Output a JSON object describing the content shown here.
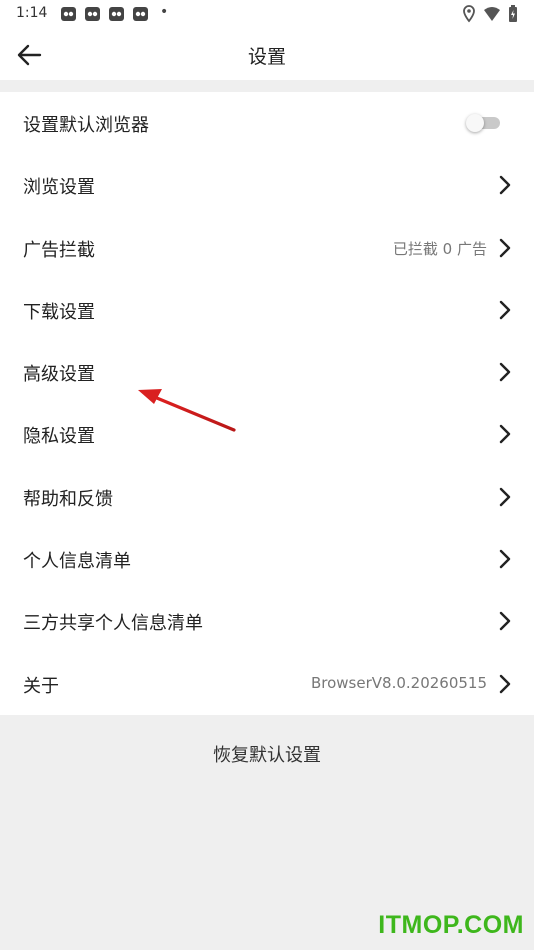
{
  "status_bar": {
    "time": "1:14",
    "notification_icons": [
      "panda-icon",
      "panda-icon",
      "panda-icon",
      "panda-icon"
    ],
    "dot": "•",
    "system_icons": [
      "location-icon",
      "wifi-icon",
      "battery-icon"
    ]
  },
  "header": {
    "title": "设置",
    "back_icon": "arrow-left-icon"
  },
  "settings": {
    "items": [
      {
        "label": "设置默认浏览器",
        "value": "",
        "control": "toggle",
        "toggle_on": false
      },
      {
        "label": "浏览设置",
        "value": "",
        "control": "chevron"
      },
      {
        "label": "广告拦截",
        "value": "已拦截 0 广告",
        "control": "chevron"
      },
      {
        "label": "下载设置",
        "value": "",
        "control": "chevron"
      },
      {
        "label": "高级设置",
        "value": "",
        "control": "chevron"
      },
      {
        "label": "隐私设置",
        "value": "",
        "control": "chevron"
      },
      {
        "label": "帮助和反馈",
        "value": "",
        "control": "chevron"
      },
      {
        "label": "个人信息清单",
        "value": "",
        "control": "chevron"
      },
      {
        "label": "三方共享个人信息清单",
        "value": "",
        "control": "chevron"
      },
      {
        "label": "关于",
        "value": "BrowserV8.0.20260515",
        "control": "chevron"
      }
    ]
  },
  "restore_label": "恢复默认设置",
  "watermark": "ITMOP.COM",
  "colors": {
    "background": "#efefef",
    "row_background": "#ffffff",
    "annotation_arrow": "#d92020",
    "watermark": "#3eb71c"
  }
}
